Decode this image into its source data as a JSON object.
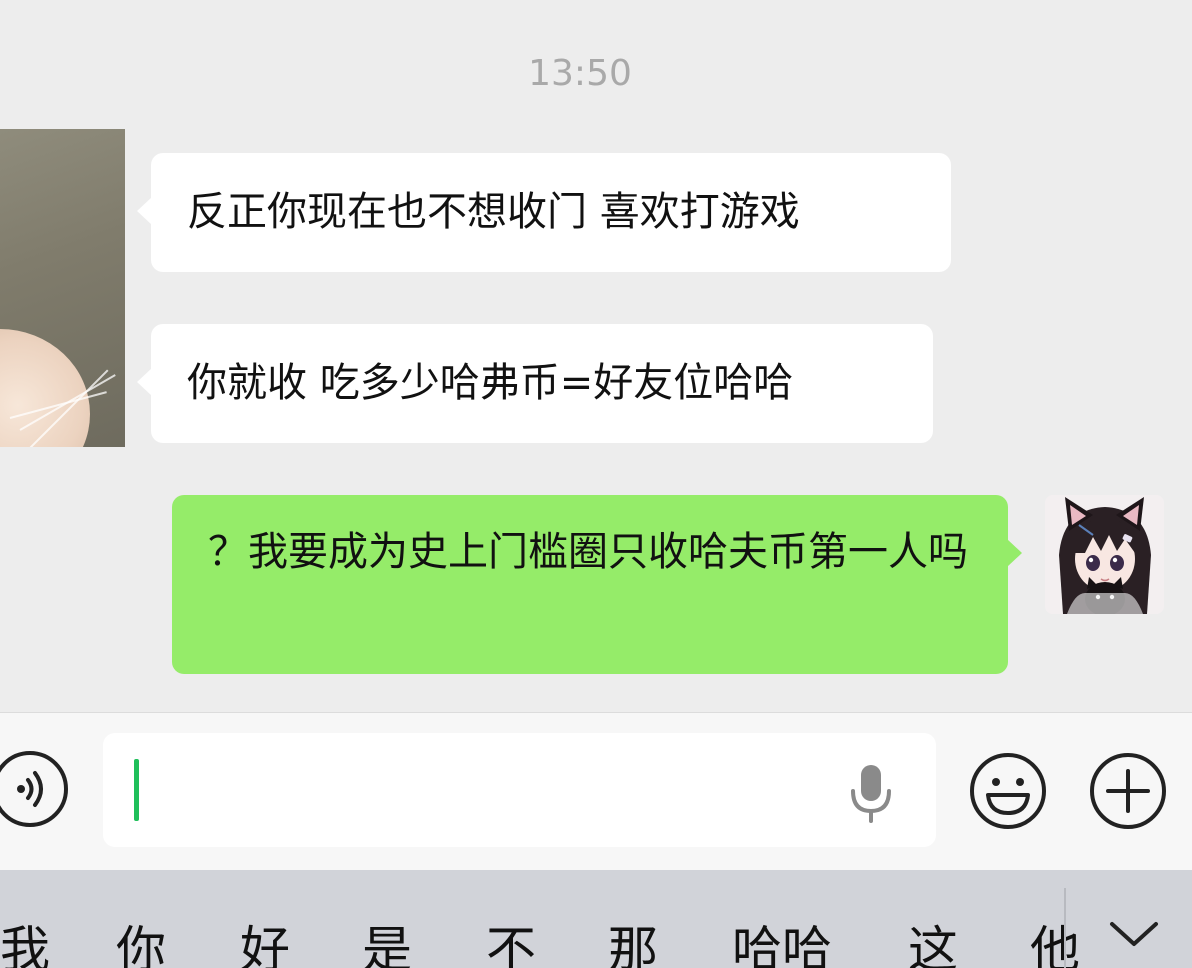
{
  "chat": {
    "timestamp": "13:50",
    "messages": [
      {
        "side": "left",
        "text": "反正你现在也不想收门 喜欢打游戏"
      },
      {
        "side": "left",
        "text": "你就收 吃多少哈弗币=好友位哈哈"
      },
      {
        "side": "right",
        "text": "？我要成为史上门槛圈只收哈夫币第一人吗"
      }
    ]
  },
  "input_bar": {
    "input_value": "",
    "icons": {
      "voice": "voice-toggle-icon",
      "mic": "microphone-icon",
      "emoji": "emoji-icon",
      "plus": "plus-icon"
    }
  },
  "keyboard": {
    "candidates": [
      "我",
      "你",
      "好",
      "是",
      "不",
      "那",
      "哈哈",
      "这",
      "他"
    ],
    "collapse_icon": "chevron-down-icon"
  },
  "colors": {
    "background": "#ededed",
    "incoming_bubble": "#ffffff",
    "outgoing_bubble": "#95ec69",
    "caret": "#1fbf5a",
    "keyboard_bar": "#d1d3d9"
  }
}
